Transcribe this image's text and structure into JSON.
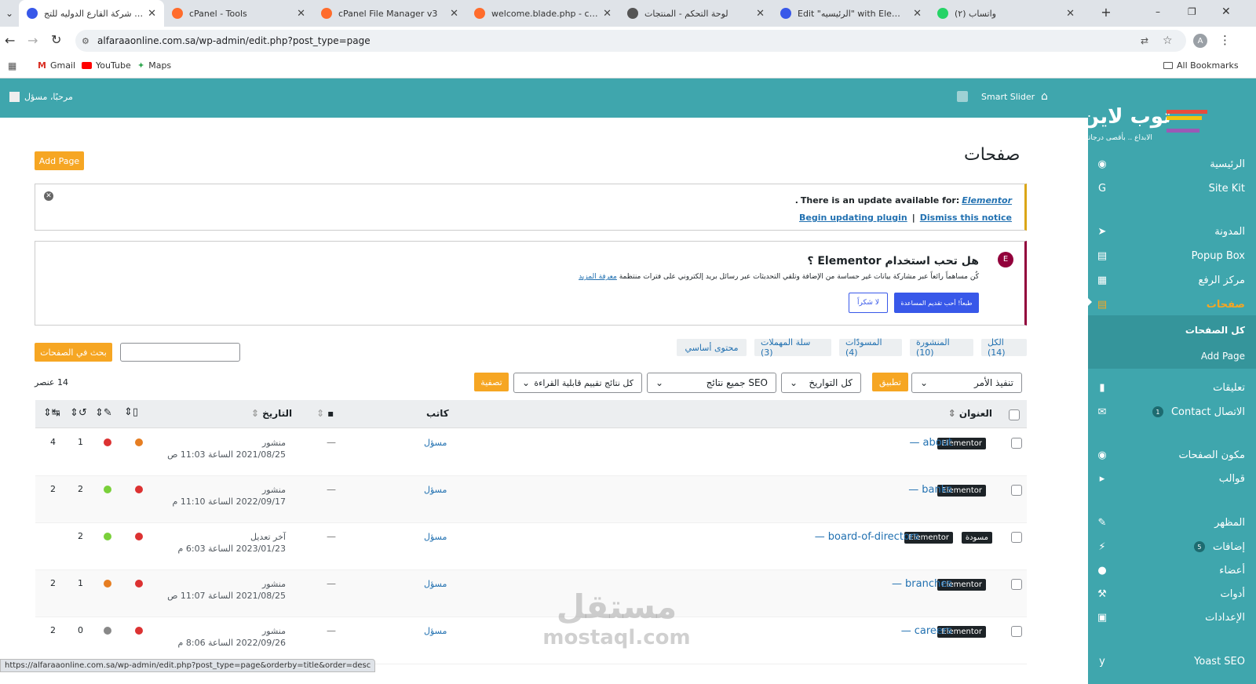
{
  "browser": {
    "tabs": [
      {
        "title": "صفحات ‹ شركة القارع الدوليه للتج",
        "icon": "wordpress-icon",
        "active": true
      },
      {
        "title": "cPanel - Tools",
        "icon": "cpanel-icon"
      },
      {
        "title": "cPanel File Manager v3",
        "icon": "cpanel-icon"
      },
      {
        "title": "welcome.blade.php - cPanel Fil",
        "icon": "cpanel-icon"
      },
      {
        "title": "لوحة التحكم - المنتجات",
        "icon": "globe-icon"
      },
      {
        "title": "Edit \"الرئيسيه\" with Elementor",
        "icon": "wordpress-icon"
      },
      {
        "title": "(٢) واتساب",
        "icon": "whatsapp-icon"
      }
    ],
    "url": "alfaraaonline.com.sa/wp-admin/edit.php?post_type=page",
    "bookmarks": [
      "Gmail",
      "YouTube",
      "Maps"
    ],
    "all_bookmarks": "All Bookmarks",
    "profile_letter": "A",
    "status_url": "https://alfaraaonline.com.sa/wp-admin/edit.php?post_type=page&orderby=title&order=desc"
  },
  "adminbar": {
    "greeting": "مرحبًا، مسؤل",
    "smart_slider": "Smart Slider"
  },
  "sidebar": {
    "logo_title": "توب لاين",
    "logo_tagline": "الابداع .. بأقصى درجاته",
    "items": [
      {
        "label": "الرئيسية",
        "icon": "dashboard-icon"
      },
      {
        "label": "Site Kit",
        "icon": "google-icon"
      },
      {
        "label": "المدونة",
        "icon": "pin-icon"
      },
      {
        "label": "Popup Box",
        "icon": "popup-icon"
      },
      {
        "label": "مركز الرفع",
        "icon": "media-icon"
      },
      {
        "label": "صفحات",
        "icon": "pages-icon"
      },
      {
        "label": "كل الصفحات",
        "icon": ""
      },
      {
        "label": "Add Page",
        "icon": ""
      },
      {
        "label": "تعليقات",
        "icon": "comment-icon"
      },
      {
        "label": "الاتصال Contact",
        "icon": "mail-icon",
        "badge": "1"
      },
      {
        "label": "مكون الصفحات",
        "icon": "elementor-icon"
      },
      {
        "label": "قوالب",
        "icon": "folder-icon"
      },
      {
        "label": "المظهر",
        "icon": "brush-icon"
      },
      {
        "label": "إضافات",
        "icon": "plugin-icon",
        "badge": "5"
      },
      {
        "label": "أعضاء",
        "icon": "user-icon"
      },
      {
        "label": "أدوات",
        "icon": "wrench-icon"
      },
      {
        "label": "الإعدادات",
        "icon": "settings-icon"
      },
      {
        "label": "Yoast SEO",
        "icon": "yoast-icon"
      }
    ]
  },
  "page": {
    "title": "صفحات",
    "add_button": "Add Page"
  },
  "update_notice": {
    "text": "There is an update available for:",
    "plugin": "Elementor",
    "end": ".",
    "begin": "Begin updating plugin",
    "sep": "|",
    "dismiss": "Dismiss this notice"
  },
  "elementor_notice": {
    "title": "هل تحب استخدام Elementor ؟",
    "body": "كُن مساهماً رائعاً عبر مشاركة بيانات غير حساسة من الإضافة وتلقي التحديثات عبر رسائل بريد إلكتروني على فترات منتظمة",
    "learn_more": "معرفة المزيد",
    "yes_button": "طبعاً! أحب تقديم المساعدة",
    "no_button": "لا شكراً"
  },
  "filters": {
    "views": [
      "الكل (14)",
      "المنشورة (10)",
      "المسودّات (4)",
      "سلة المهملات (3)",
      "محتوى أساسي"
    ],
    "search_button": "بحث في الصفحات",
    "search_value": "",
    "bulk_action": "تنفيذ الأمر",
    "apply": "تطبيق",
    "dates": "كل التواريخ",
    "seo": "جميع نتائج SEO",
    "readability": "كل نتائج تقييم قابلية القراءة",
    "filter_button": "تصفية",
    "count": "14 عنصر"
  },
  "table": {
    "headers": {
      "title": "العنوان",
      "author": "كاتب",
      "date": "التاريخ"
    },
    "rows": [
      {
        "title": "about",
        "badge": "Elementor",
        "draft": "",
        "author": "مسؤل",
        "comments": "—",
        "status": "منشور",
        "date": "2021/08/25 الساعة 11:03 ص",
        "seo": "#e67e22",
        "read": "#dc3232",
        "links": "1",
        "incoming": "4"
      },
      {
        "title": "banks",
        "badge": "Elementor",
        "draft": "",
        "author": "مسؤل",
        "comments": "—",
        "status": "منشور",
        "date": "2022/09/17 الساعة 11:10 م",
        "seo": "#dc3232",
        "read": "#7ad03a",
        "links": "2",
        "incoming": "2"
      },
      {
        "title": "board-of-directors",
        "badge": "Elementor",
        "draft": "مسودة",
        "author": "مسؤل",
        "comments": "—",
        "status": "آخر تعديل",
        "date": "2023/01/23 الساعة 6:03 م",
        "seo": "#dc3232",
        "read": "#7ad03a",
        "links": "2",
        "incoming": ""
      },
      {
        "title": "branches",
        "badge": "Elementor",
        "draft": "",
        "author": "مسؤل",
        "comments": "—",
        "status": "منشور",
        "date": "2021/08/25 الساعة 11:07 ص",
        "seo": "#dc3232",
        "read": "#e67e22",
        "links": "1",
        "incoming": "2"
      },
      {
        "title": "careers",
        "badge": "Elementor",
        "draft": "",
        "author": "مسؤل",
        "comments": "—",
        "status": "منشور",
        "date": "2022/09/26 الساعة 8:06 م",
        "seo": "#dc3232",
        "read": "#888888",
        "links": "0",
        "incoming": "2"
      }
    ]
  },
  "watermark": {
    "arabic": "مستقل",
    "latin": "mostaql.com"
  },
  "colors": {
    "admin": "#3fa6ad",
    "accent": "#f6a623",
    "active_menu": "#f6a623",
    "link": "#2271b1"
  }
}
